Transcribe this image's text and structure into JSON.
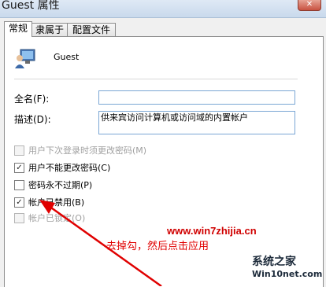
{
  "window": {
    "title": "Guest 属性",
    "close_glyph": "✕"
  },
  "tabs": [
    {
      "label": "常规",
      "active": true
    },
    {
      "label": "隶属于",
      "active": false
    },
    {
      "label": "配置文件",
      "active": false
    }
  ],
  "user": {
    "name": "Guest",
    "icon": "user-monitor-icon"
  },
  "fields": {
    "fullname_label": "全名(F):",
    "fullname_value": "",
    "description_label": "描述(D):",
    "description_value": "供来宾访问计算机或访问域的内置帐户"
  },
  "options": [
    {
      "label": "用户下次登录时须更改密码(M)",
      "checked": false,
      "disabled": true
    },
    {
      "label": "用户不能更改密码(C)",
      "checked": true,
      "disabled": false
    },
    {
      "label": "密码永不过期(P)",
      "checked": false,
      "disabled": false
    },
    {
      "label": "帐户已禁用(B)",
      "checked": true,
      "disabled": false
    },
    {
      "label": "帐户已锁定(O)",
      "checked": false,
      "disabled": true
    }
  ],
  "annotation": {
    "text": "去掉勾，然后点击应用",
    "site1": "www.win7zhijia.cn",
    "site2": "系统之家",
    "site3": "Win10net.com"
  },
  "colors": {
    "accent": "#7aa6d4",
    "annotation": "#e00000"
  }
}
